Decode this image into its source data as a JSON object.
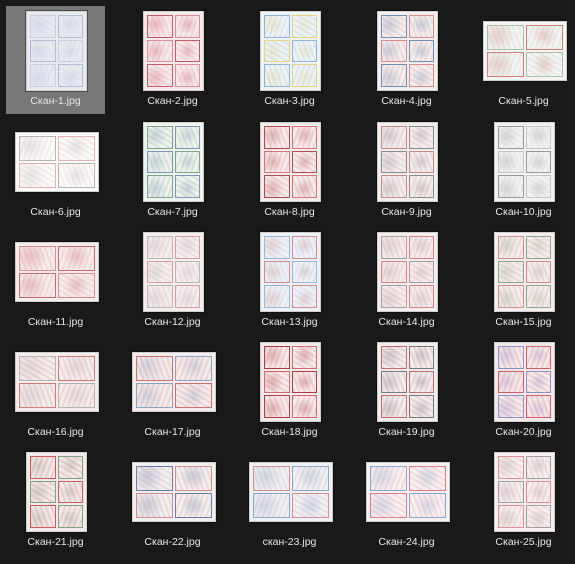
{
  "selected_index": 0,
  "files": [
    {
      "name": "Скан-1.jpg",
      "orientation": "portrait",
      "palette": [
        "#e8eaef",
        "#c9cfe0",
        "#b2bdd6"
      ]
    },
    {
      "name": "Скан-2.jpg",
      "orientation": "portrait",
      "palette": [
        "#f6eaec",
        "#df8e99",
        "#c85b6a"
      ]
    },
    {
      "name": "Скан-3.jpg",
      "orientation": "portrait",
      "palette": [
        "#eef3f6",
        "#8fb4d9",
        "#e6d37a"
      ]
    },
    {
      "name": "Скан-4.jpg",
      "orientation": "portrait",
      "palette": [
        "#f4eeee",
        "#d98a8a",
        "#6b8fb8"
      ]
    },
    {
      "name": "Скан-5.jpg",
      "orientation": "landscape",
      "palette": [
        "#f4f5f3",
        "#a9c0a8",
        "#d37c7c"
      ]
    },
    {
      "name": "Скан-6.jpg",
      "orientation": "landscape",
      "palette": [
        "#fbfbfb",
        "#e7b2b2",
        "#b5b5b5"
      ]
    },
    {
      "name": "Скан-7.jpg",
      "orientation": "portrait",
      "palette": [
        "#eef3ef",
        "#7fa58a",
        "#7e95b5"
      ]
    },
    {
      "name": "Скан-8.jpg",
      "orientation": "portrait",
      "palette": [
        "#f5ecec",
        "#d8757a",
        "#b24c52"
      ]
    },
    {
      "name": "Скан-9.jpg",
      "orientation": "portrait",
      "palette": [
        "#f3eeee",
        "#c98a8a",
        "#8c8c8c"
      ]
    },
    {
      "name": "Скан-10.jpg",
      "orientation": "portrait",
      "palette": [
        "#f1f1f1",
        "#c7c7c7",
        "#9a9a9a"
      ]
    },
    {
      "name": "Скан-11.jpg",
      "orientation": "landscape",
      "palette": [
        "#f6ecec",
        "#de8f96",
        "#c96a72"
      ]
    },
    {
      "name": "Скан-12.jpg",
      "orientation": "portrait",
      "palette": [
        "#f4eeee",
        "#d79da0",
        "#b8b8b8"
      ]
    },
    {
      "name": "Скан-13.jpg",
      "orientation": "portrait",
      "palette": [
        "#eef2f7",
        "#9fb7d6",
        "#d78a8a"
      ]
    },
    {
      "name": "Скан-14.jpg",
      "orientation": "portrait",
      "palette": [
        "#f5eded",
        "#d98386",
        "#a3a3a3"
      ]
    },
    {
      "name": "Скан-15.jpg",
      "orientation": "portrait",
      "palette": [
        "#f4eded",
        "#d58a8c",
        "#8fa98f"
      ]
    },
    {
      "name": "Скан-16.jpg",
      "orientation": "landscape",
      "palette": [
        "#f5ecec",
        "#d07c7f",
        "#b5b5b5"
      ]
    },
    {
      "name": "Скан-17.jpg",
      "orientation": "landscape",
      "palette": [
        "#f5ecec",
        "#cf6e73",
        "#8aa4c4"
      ]
    },
    {
      "name": "Скан-18.jpg",
      "orientation": "portrait",
      "palette": [
        "#f5ebeb",
        "#d46a71",
        "#ac3c45"
      ]
    },
    {
      "name": "Скан-19.jpg",
      "orientation": "portrait",
      "palette": [
        "#f2eeee",
        "#c86c72",
        "#7a7a7a"
      ]
    },
    {
      "name": "Скан-20.jpg",
      "orientation": "portrait",
      "palette": [
        "#f5eaeb",
        "#d65d69",
        "#8f93c9"
      ]
    },
    {
      "name": "Скан-21.jpg",
      "orientation": "portrait",
      "palette": [
        "#f4eaea",
        "#d0585f",
        "#7aa47e"
      ]
    },
    {
      "name": "Скан-22.jpg",
      "orientation": "landscape",
      "palette": [
        "#f2efef",
        "#d78b90",
        "#6d7fa7"
      ]
    },
    {
      "name": "скан-23.jpg",
      "orientation": "landscape",
      "palette": [
        "#eef1f5",
        "#d48f93",
        "#8ea6c6"
      ]
    },
    {
      "name": "Скан-24.jpg",
      "orientation": "landscape",
      "palette": [
        "#f8f1f2",
        "#e07c8c",
        "#8aa7cf"
      ]
    },
    {
      "name": "Скан-25.jpg",
      "orientation": "portrait",
      "palette": [
        "#f7eeee",
        "#e08f96",
        "#9e9e9e"
      ]
    }
  ]
}
